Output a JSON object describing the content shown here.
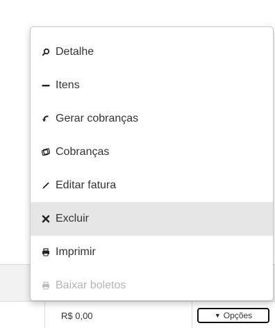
{
  "menu": {
    "items": [
      {
        "label": "Detalhe",
        "icon": "search-icon"
      },
      {
        "label": "Itens",
        "icon": "minus-icon"
      },
      {
        "label": "Gerar cobranças",
        "icon": "undo-icon"
      },
      {
        "label": "Cobranças",
        "icon": "tickets-icon"
      },
      {
        "label": "Editar fatura",
        "icon": "pencil-icon"
      },
      {
        "label": "Excluir",
        "icon": "close-icon",
        "state": "hover"
      },
      {
        "label": "Imprimir",
        "icon": "print-icon"
      },
      {
        "label": "Baixar boletos",
        "icon": "print-icon",
        "state": "disabled"
      }
    ]
  },
  "table": {
    "price": "R$ 0,00",
    "options_button": "Opções"
  },
  "colors": {
    "hover_bg": "#e6e6e6",
    "disabled_text": "#b5b5b5",
    "text": "#333333"
  }
}
